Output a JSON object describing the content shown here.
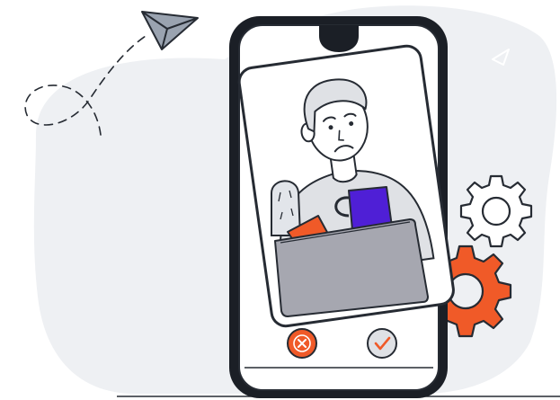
{
  "illustration": {
    "subject": "sad-worker-swipe-card",
    "colors": {
      "blob": "#eef0f3",
      "outline": "#262b33",
      "accent_orange": "#f05a28",
      "accent_purple": "#4f1fd6",
      "laptop": "#a6a7b0",
      "shirt": "#dfe1e5",
      "cactus": "#e2e5ea"
    }
  },
  "actions": {
    "reject_icon": "close-icon",
    "accept_icon": "check-icon"
  }
}
